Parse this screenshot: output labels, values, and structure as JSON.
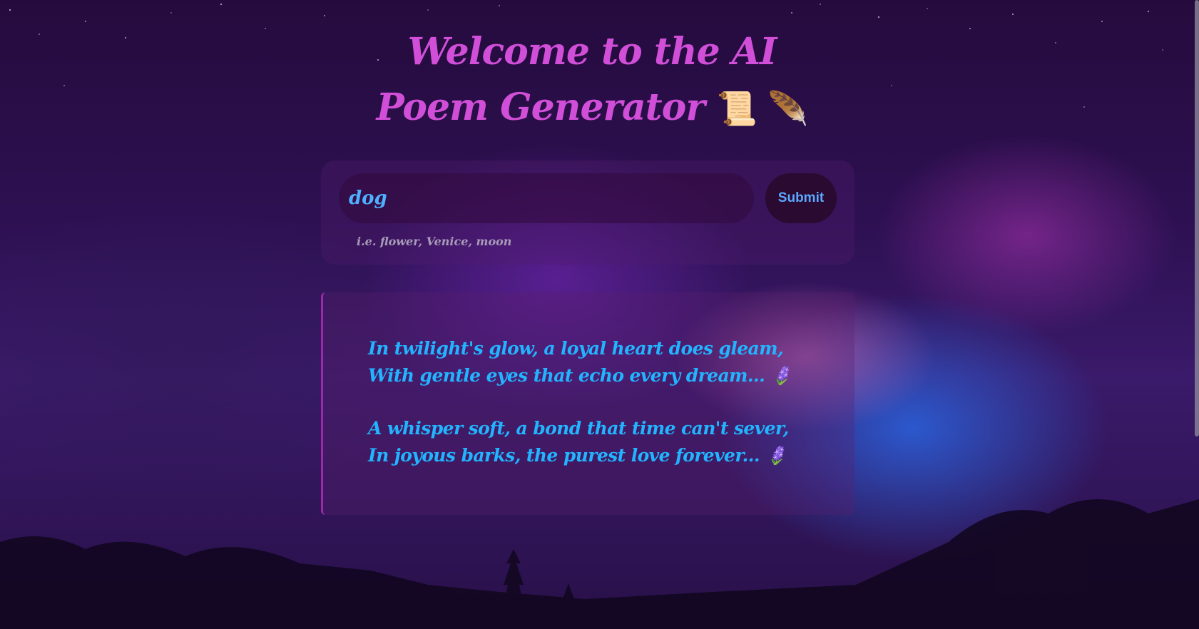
{
  "page": {
    "title": "Welcome to the AI Poem Generator",
    "title_emoji": "📜 🪶"
  },
  "form": {
    "input_value": "dog",
    "submit_label": "Submit",
    "hint": "i.e. flower, Venice, moon"
  },
  "poem": {
    "stanzas": [
      {
        "lines": [
          "In twilight's glow, a loyal heart does gleam,",
          "With gentle eyes that echo every dream... 🪻"
        ]
      },
      {
        "lines": [
          "A whisper soft, a bond that time can't sever,",
          "In joyous barks, the purest love forever... 🪻"
        ]
      }
    ]
  },
  "colors": {
    "title": "#d14fd8",
    "poem_text": "#22b4ff",
    "input_text": "#4fb0ff",
    "submit_text": "#5aa8ff",
    "poem_border": "#9a2aa8"
  }
}
